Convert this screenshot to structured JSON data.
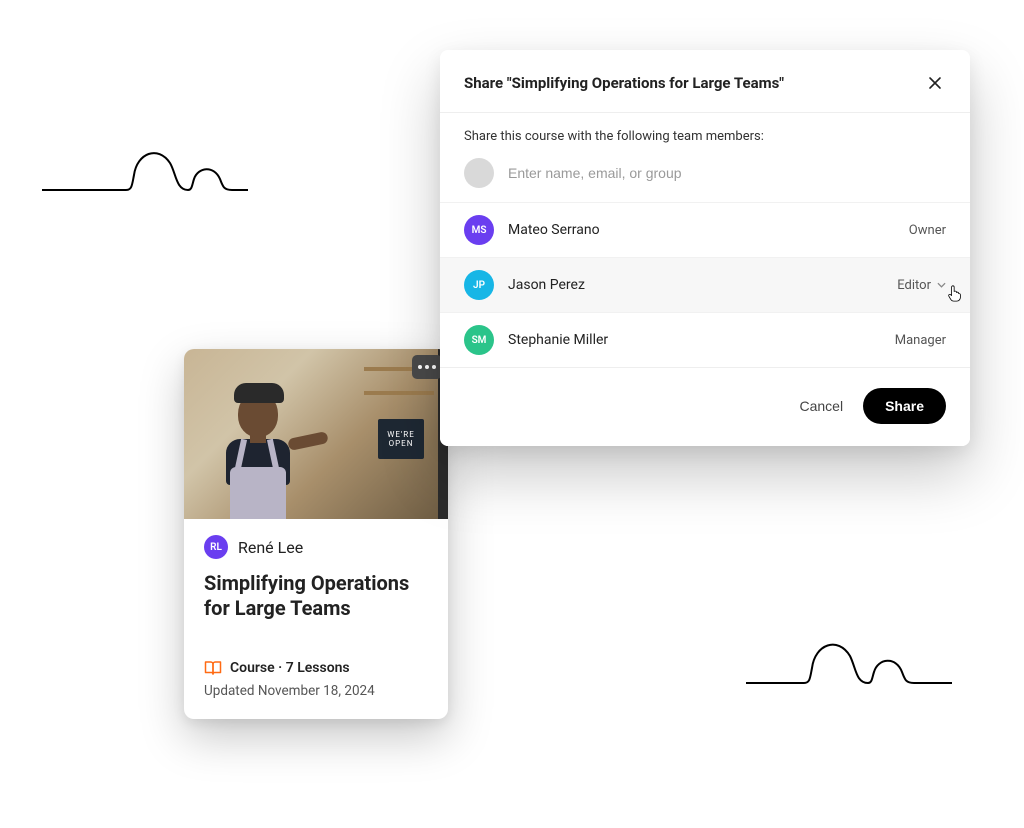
{
  "card": {
    "author_initials": "RL",
    "author_name": "René Lee",
    "author_avatar_bg": "#6a3ef0",
    "title": "Simplifying Operations for Large Teams",
    "meta_line": "Course · 7 Lessons",
    "updated_line": "Updated November 18, 2024",
    "image_sign_text": "WE'RE OPEN"
  },
  "dialog": {
    "title": "Share \"Simplifying Operations for Large Teams\"",
    "subtitle": "Share this course with the following team members:",
    "input_placeholder": "Enter name, email, or group",
    "members": [
      {
        "initials": "MS",
        "name": "Mateo Serrano",
        "role": "Owner",
        "avatar_bg": "#6a3ef0",
        "hovered": false,
        "role_dropdown": false
      },
      {
        "initials": "JP",
        "name": "Jason Perez",
        "role": "Editor",
        "avatar_bg": "#17b6e6",
        "hovered": true,
        "role_dropdown": true
      },
      {
        "initials": "SM",
        "name": "Stephanie Miller",
        "role": "Manager",
        "avatar_bg": "#2bc48a",
        "hovered": false,
        "role_dropdown": false
      }
    ],
    "cancel_label": "Cancel",
    "share_label": "Share"
  }
}
